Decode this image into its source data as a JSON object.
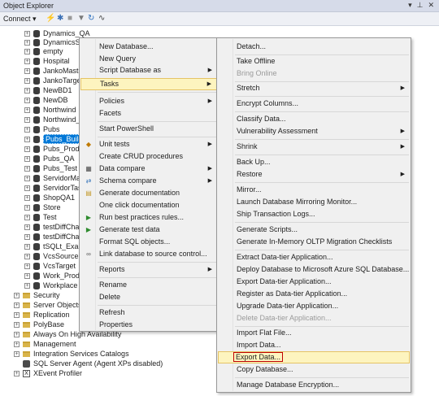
{
  "window": {
    "title": "Object Explorer"
  },
  "toolbar": {
    "connect_label": "Connect ▾"
  },
  "tree": {
    "databases": [
      "Dynamics_QA",
      "DynamicsS",
      "empty",
      "Hospital",
      "JankoMaste",
      "JankoTarge",
      "NewBD1",
      "NewDB",
      "Northwind",
      "Northwind_",
      "Pubs",
      "Pubs_Build",
      "Pubs_Produ",
      "Pubs_QA",
      "Pubs_Test",
      "ServidorMa",
      "ServidorTas",
      "ShopQA1",
      "Store",
      "Test",
      "testDiffCha",
      "testDiffCha",
      "tSQLt_Exam",
      "VcsSource",
      "VcsTarget",
      "Work_Prod",
      "Workplace"
    ],
    "folders": [
      "Security",
      "Server Objects",
      "Replication",
      "PolyBase",
      "Always On High Availability",
      "Management",
      "Integration Services Catalogs"
    ],
    "agent": "SQL Server Agent (Agent XPs disabled)",
    "xevent": "XEvent Profiler"
  },
  "context_menu": {
    "items": [
      "New Database...",
      "New Query",
      "Script Database as",
      "Tasks",
      "Policies",
      "Facets",
      "Start PowerShell",
      "Unit tests",
      "Create CRUD procedures",
      "Data compare",
      "Schema compare",
      "Generate documentation",
      "One click documentation",
      "Run best practices rules...",
      "Generate test data",
      "Format SQL objects...",
      "Link database to source control...",
      "Reports",
      "Rename",
      "Delete",
      "Refresh",
      "Properties"
    ]
  },
  "tasks_menu": {
    "items": [
      "Detach...",
      "Take Offline",
      "Bring Online",
      "Stretch",
      "Encrypt Columns...",
      "Classify Data...",
      "Vulnerability Assessment",
      "Shrink",
      "Back Up...",
      "Restore",
      "Mirror...",
      "Launch Database Mirroring Monitor...",
      "Ship Transaction Logs...",
      "Generate Scripts...",
      "Generate In-Memory OLTP Migration Checklists",
      "Extract Data-tier Application...",
      "Deploy Database to Microsoft Azure SQL Database...",
      "Export Data-tier Application...",
      "Register as Data-tier Application...",
      "Upgrade Data-tier Application...",
      "Delete Data-tier Application...",
      "Import Flat File...",
      "Import Data...",
      "Export Data...",
      "Copy Database...",
      "Manage Database Encryption..."
    ]
  },
  "icons": [
    "pin-icon",
    "close-icon",
    "connect-icon",
    "filter-icon",
    "stop-icon",
    "refresh-icon",
    "activity-icon",
    "database-icon",
    "folder-icon"
  ]
}
